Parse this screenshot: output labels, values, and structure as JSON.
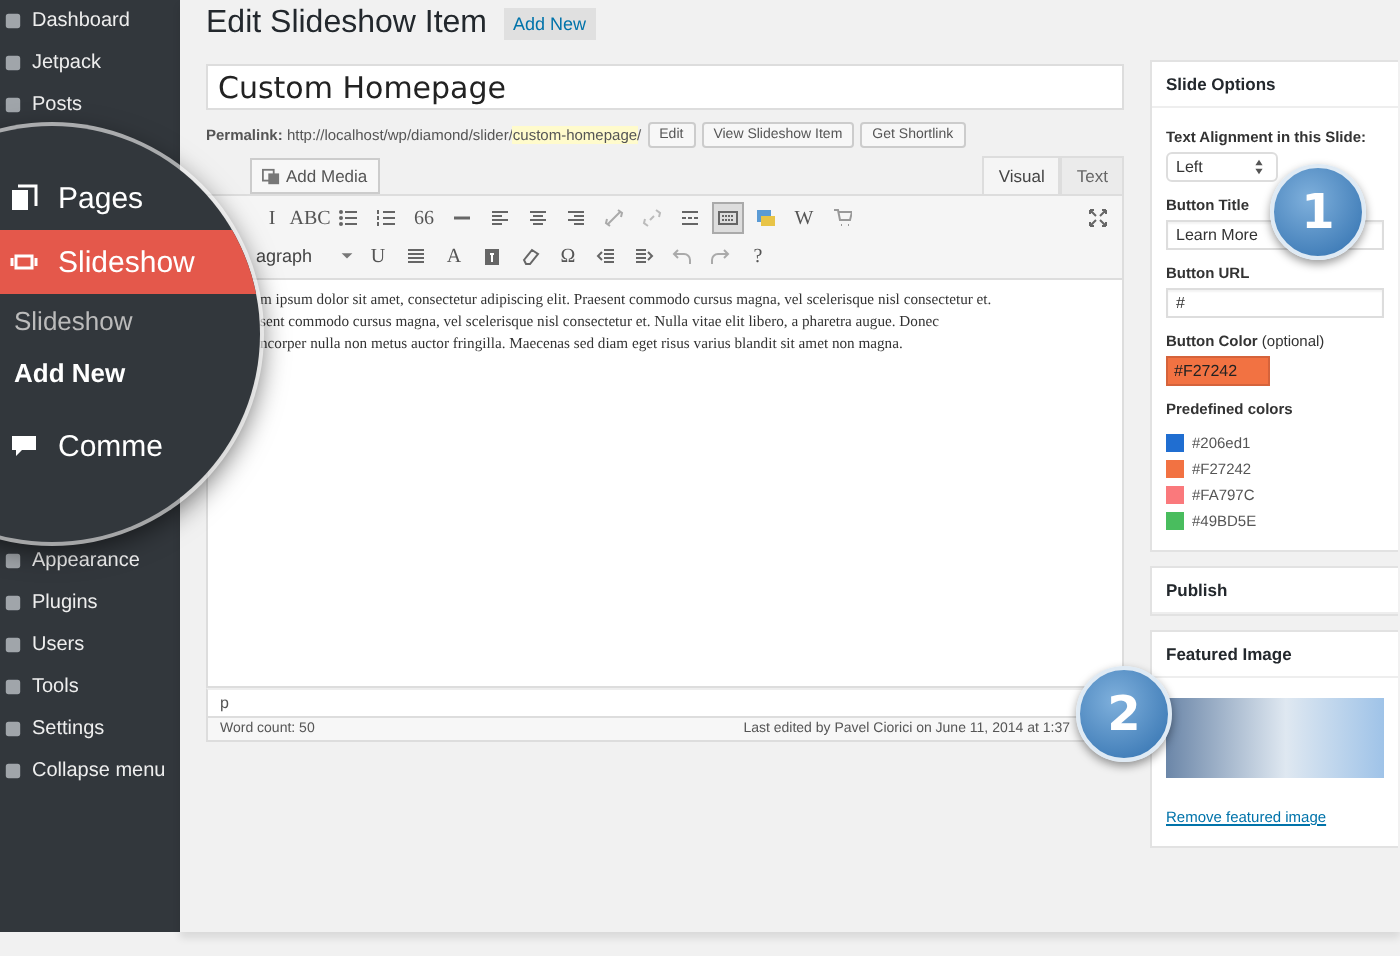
{
  "sidebar": {
    "items_top": [
      {
        "label": "Dashboard"
      },
      {
        "label": "Jetpack"
      },
      {
        "label": "Posts"
      }
    ],
    "magnifier": [
      {
        "kind": "menu",
        "label": "Pages",
        "selected": false
      },
      {
        "kind": "menu",
        "label": "Slideshow",
        "selected": true
      },
      {
        "kind": "sub",
        "label": "Slideshow",
        "selected": false
      },
      {
        "kind": "sub",
        "label": "Add New",
        "selected": true
      },
      {
        "kind": "menu",
        "label": "Comme",
        "selected": false
      }
    ],
    "items_bottom": [
      {
        "label": "Appearance"
      },
      {
        "label": "Plugins"
      },
      {
        "label": "Users"
      },
      {
        "label": "Tools"
      },
      {
        "label": "Settings"
      },
      {
        "label": "Collapse menu"
      }
    ]
  },
  "header": {
    "title": "Edit Slideshow Item",
    "button": "Add New"
  },
  "post": {
    "title": "Custom Homepage",
    "permalink_label": "Permalink:",
    "permalink_base": "http://localhost/wp/diamond/slider/",
    "permalink_slug": "custom-homepage",
    "permalink_end": "/",
    "buttons": [
      "Edit",
      "View Slideshow Item",
      "Get Shortlink"
    ]
  },
  "editor": {
    "add_media": "Add Media",
    "tabs": [
      {
        "label": "Visual",
        "selected": true
      },
      {
        "label": "Text",
        "selected": false
      }
    ],
    "toolbar_row_1": [
      {
        "kind": "glyph",
        "label": "I",
        "pressed": false
      },
      {
        "kind": "glyph",
        "label": "ABC",
        "pressed": false
      },
      {
        "kind": "icon",
        "pressed": false
      },
      {
        "kind": "icon",
        "pressed": false
      },
      {
        "kind": "glyph",
        "label": "66",
        "pressed": false
      },
      {
        "kind": "icon",
        "pressed": false
      },
      {
        "kind": "icon",
        "pressed": false
      },
      {
        "kind": "icon",
        "pressed": false
      },
      {
        "kind": "icon",
        "pressed": false
      },
      {
        "kind": "icon",
        "pressed": false
      },
      {
        "kind": "icon",
        "pressed": false
      },
      {
        "kind": "icon",
        "pressed": false
      },
      {
        "kind": "icon",
        "pressed": true
      },
      {
        "kind": "icon",
        "pressed": false
      },
      {
        "kind": "glyph",
        "label": "W",
        "pressed": false
      },
      {
        "kind": "icon",
        "pressed": false
      }
    ],
    "format": "agraph",
    "toolbar_row_2": [
      {
        "kind": "glyph",
        "label": "U",
        "pressed": false
      },
      {
        "kind": "icon",
        "pressed": false
      },
      {
        "kind": "glyph",
        "label": "A",
        "pressed": false
      },
      {
        "kind": "icon",
        "pressed": false
      },
      {
        "kind": "icon",
        "pressed": false
      },
      {
        "kind": "glyph",
        "label": "Ω",
        "pressed": false
      },
      {
        "kind": "icon",
        "pressed": false
      },
      {
        "kind": "icon",
        "pressed": false
      },
      {
        "kind": "icon",
        "pressed": false
      },
      {
        "kind": "icon",
        "pressed": false
      },
      {
        "kind": "glyph",
        "label": "?",
        "pressed": false
      }
    ],
    "lines": [
      "m ipsum dolor sit amet, consectetur adipiscing elit. Praesent commodo cursus magna, vel scelerisque nisl consectetur et.",
      "sent commodo cursus magna, vel scelerisque nisl consectetur et. Nulla vitae elit libero, a pharetra augue. Donec",
      "ncorper nulla non metus auctor fringilla. Maecenas sed diam eget risus varius blandit sit amet non magna."
    ],
    "path": "p",
    "word_count": "Word count: 50",
    "last_edited": "Last edited by Pavel Ciorici on June 11, 2014 at 1:37"
  },
  "slide_options": {
    "title": "Slide Options",
    "alignment_label": "Text Alignment in this Slide:",
    "alignment": "Left",
    "button_title_label": "Button Title",
    "button_title": "Learn More",
    "button_url_label": "Button URL",
    "button_url": "#",
    "button_color_label": "Button Color",
    "button_color_note": "(optional)",
    "button_color": "#F27242",
    "predefined_label": "Predefined colors",
    "colors": [
      {
        "label": "#206ed1",
        "color": "#206ed1"
      },
      {
        "label": "#F27242",
        "color": "#f27242"
      },
      {
        "label": "#FA797C",
        "color": "#fa797c"
      },
      {
        "label": "#49BD5E",
        "color": "#49bd5e"
      }
    ]
  },
  "publish": {
    "title": "Publish"
  },
  "featured_image": {
    "title": "Featured Image",
    "remove": "Remove featured image"
  },
  "callouts": [
    "1",
    "2"
  ]
}
